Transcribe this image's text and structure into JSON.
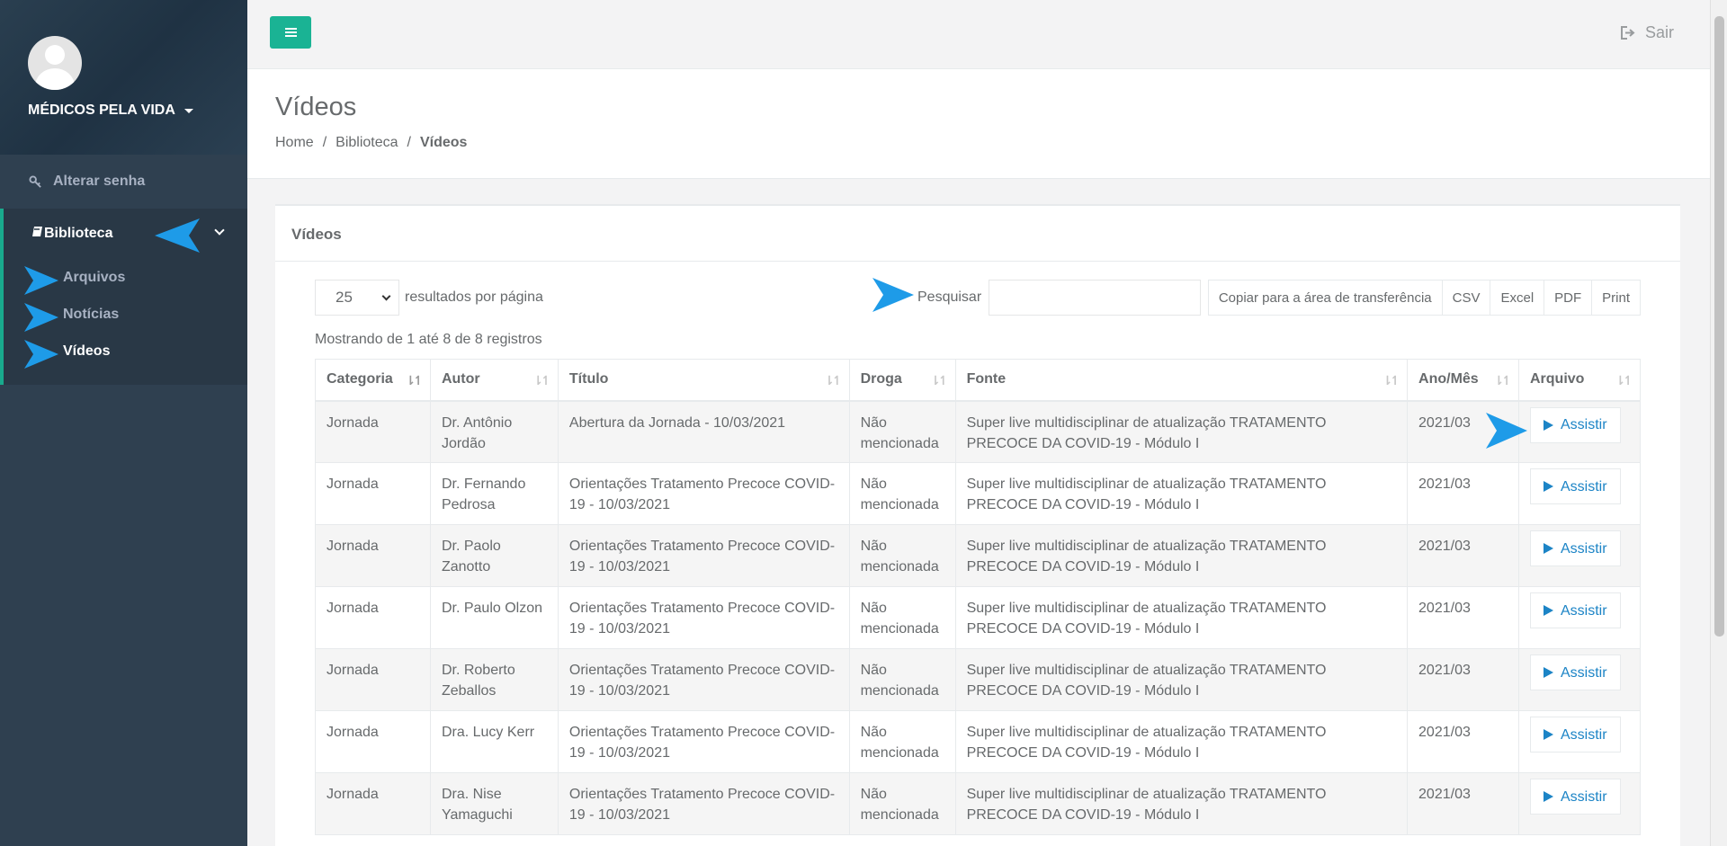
{
  "sidebar": {
    "profile_name": "MÉDICOS PELA VIDA",
    "change_password": "Alterar senha",
    "library": "Biblioteca",
    "sub_items": [
      "Arquivos",
      "Notícias",
      "Vídeos"
    ]
  },
  "topbar": {
    "logout_label": "Sair"
  },
  "heading": {
    "title": "Vídeos",
    "breadcrumb": [
      "Home",
      "Biblioteca",
      "Vídeos"
    ],
    "separator": "/"
  },
  "panel": {
    "title": "Vídeos",
    "page_length": "25",
    "page_length_label": "resultados por página",
    "search_label": "Pesquisar",
    "buttons": [
      "Copiar para a área de transferência",
      "CSV",
      "Excel",
      "PDF",
      "Print"
    ],
    "info": "Mostrando de 1 até 8 de 8 registros"
  },
  "table": {
    "columns": [
      "Categoria",
      "Autor",
      "Título",
      "Droga",
      "Fonte",
      "Ano/Mês",
      "Arquivo"
    ],
    "watch_label": "Assistir",
    "rows": [
      [
        "Jornada",
        "Dr. Antônio Jordão",
        "Abertura da Jornada - 10/03/2021",
        "Não mencionada",
        "Super live multidisciplinar de atualização TRATAMENTO PRECOCE DA COVID-19 - Módulo I",
        "2021/03"
      ],
      [
        "Jornada",
        "Dr. Fernando Pedrosa",
        "Orientações Tratamento Precoce COVID-19 - 10/03/2021",
        "Não mencionada",
        "Super live multidisciplinar de atualização TRATAMENTO PRECOCE DA COVID-19 - Módulo I",
        "2021/03"
      ],
      [
        "Jornada",
        "Dr. Paolo Zanotto",
        "Orientações Tratamento Precoce COVID-19 - 10/03/2021",
        "Não mencionada",
        "Super live multidisciplinar de atualização TRATAMENTO PRECOCE DA COVID-19 - Módulo I",
        "2021/03"
      ],
      [
        "Jornada",
        "Dr. Paulo Olzon",
        "Orientações Tratamento Precoce COVID-19 - 10/03/2021",
        "Não mencionada",
        "Super live multidisciplinar de atualização TRATAMENTO PRECOCE DA COVID-19 - Módulo I",
        "2021/03"
      ],
      [
        "Jornada",
        "Dr. Roberto Zeballos",
        "Orientações Tratamento Precoce COVID-19 - 10/03/2021",
        "Não mencionada",
        "Super live multidisciplinar de atualização TRATAMENTO PRECOCE DA COVID-19 - Módulo I",
        "2021/03"
      ],
      [
        "Jornada",
        "Dra. Lucy Kerr",
        "Orientações Tratamento Precoce COVID-19 - 10/03/2021",
        "Não mencionada",
        "Super live multidisciplinar de atualização TRATAMENTO PRECOCE DA COVID-19 - Módulo I",
        "2021/03"
      ],
      [
        "Jornada",
        "Dra. Nise Yamaguchi",
        "Orientações Tratamento Precoce COVID-19 - 10/03/2021",
        "Não mencionada",
        "Super live multidisciplinar de atualização TRATAMENTO PRECOCE DA COVID-19 - Módulo I",
        "2021/03"
      ]
    ]
  },
  "colors": {
    "accent": "#1ab394",
    "sidebar": "#2f4050",
    "link": "#1c84c6",
    "annotation": "#1e9be8"
  }
}
